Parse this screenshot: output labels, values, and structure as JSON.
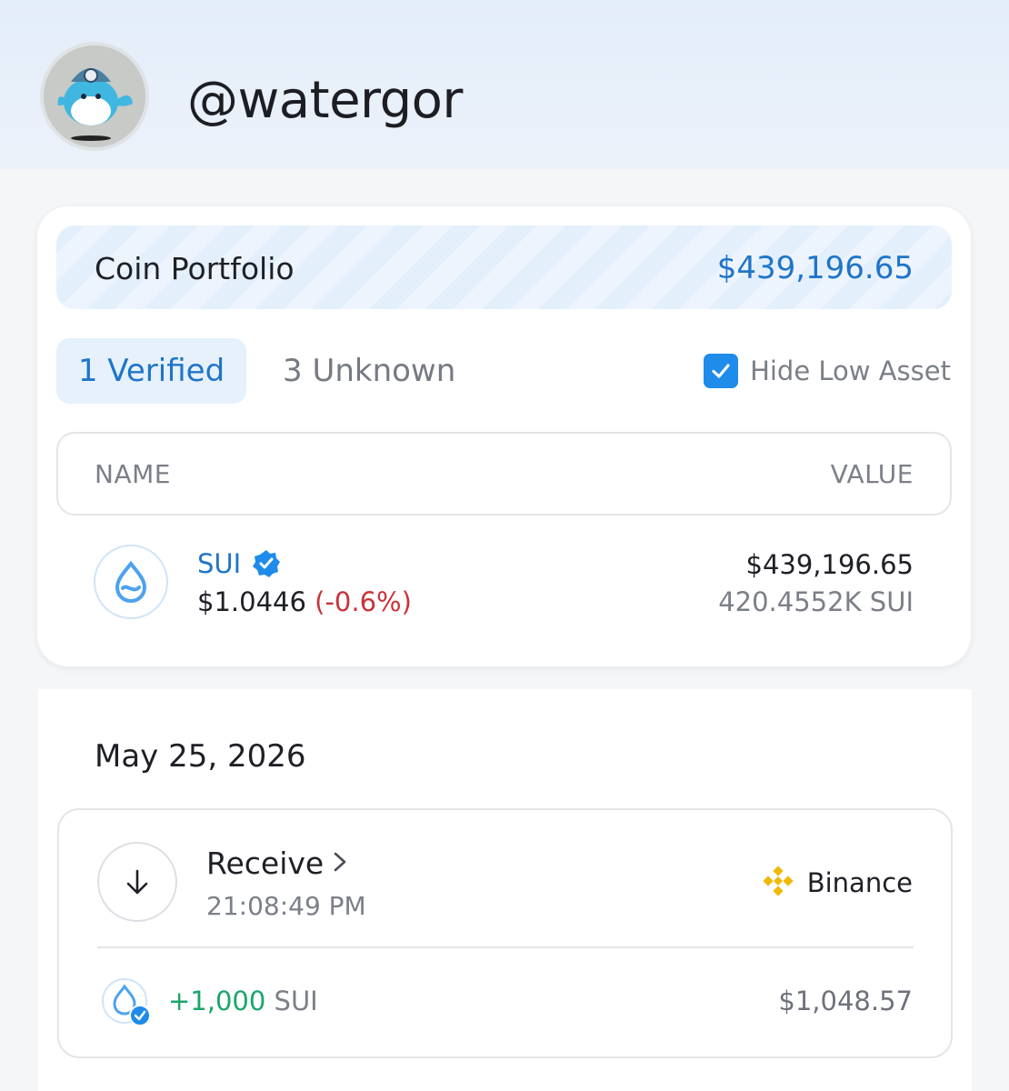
{
  "profile": {
    "username": "@watergor",
    "avatar_icon": "whale-avatar"
  },
  "portfolio": {
    "label": "Coin Portfolio",
    "total_value": "$439,196.65",
    "accent_color": "#1f75c9"
  },
  "tabs": [
    {
      "label": "1 Verified",
      "active": true
    },
    {
      "label": "3 Unknown",
      "active": false
    }
  ],
  "filter": {
    "label": "Hide Low Asset",
    "checked": true,
    "icon": "checkbox-checked-icon"
  },
  "table": {
    "columns": [
      "NAME",
      "VALUE"
    ],
    "rows": [
      {
        "name": "SUI",
        "icon": "sui-droplet-icon",
        "verified_icon": "verified-badge-icon",
        "price": "$1.0446",
        "change": "(-0.6%)",
        "change_color": "#c8323a",
        "value": "$439,196.65",
        "amount": "420.4552K SUI"
      }
    ]
  },
  "transactions": {
    "date": "May 25, 2026",
    "items": [
      {
        "type": "Receive",
        "type_icon": "arrow-down-icon",
        "time": "21:08:49 PM",
        "source": "Binance",
        "source_icon": "binance-logo-icon",
        "amount": "+1,000",
        "unit": "SUI",
        "amount_color": "#1aa66b",
        "value": "$1,048.57"
      }
    ]
  }
}
